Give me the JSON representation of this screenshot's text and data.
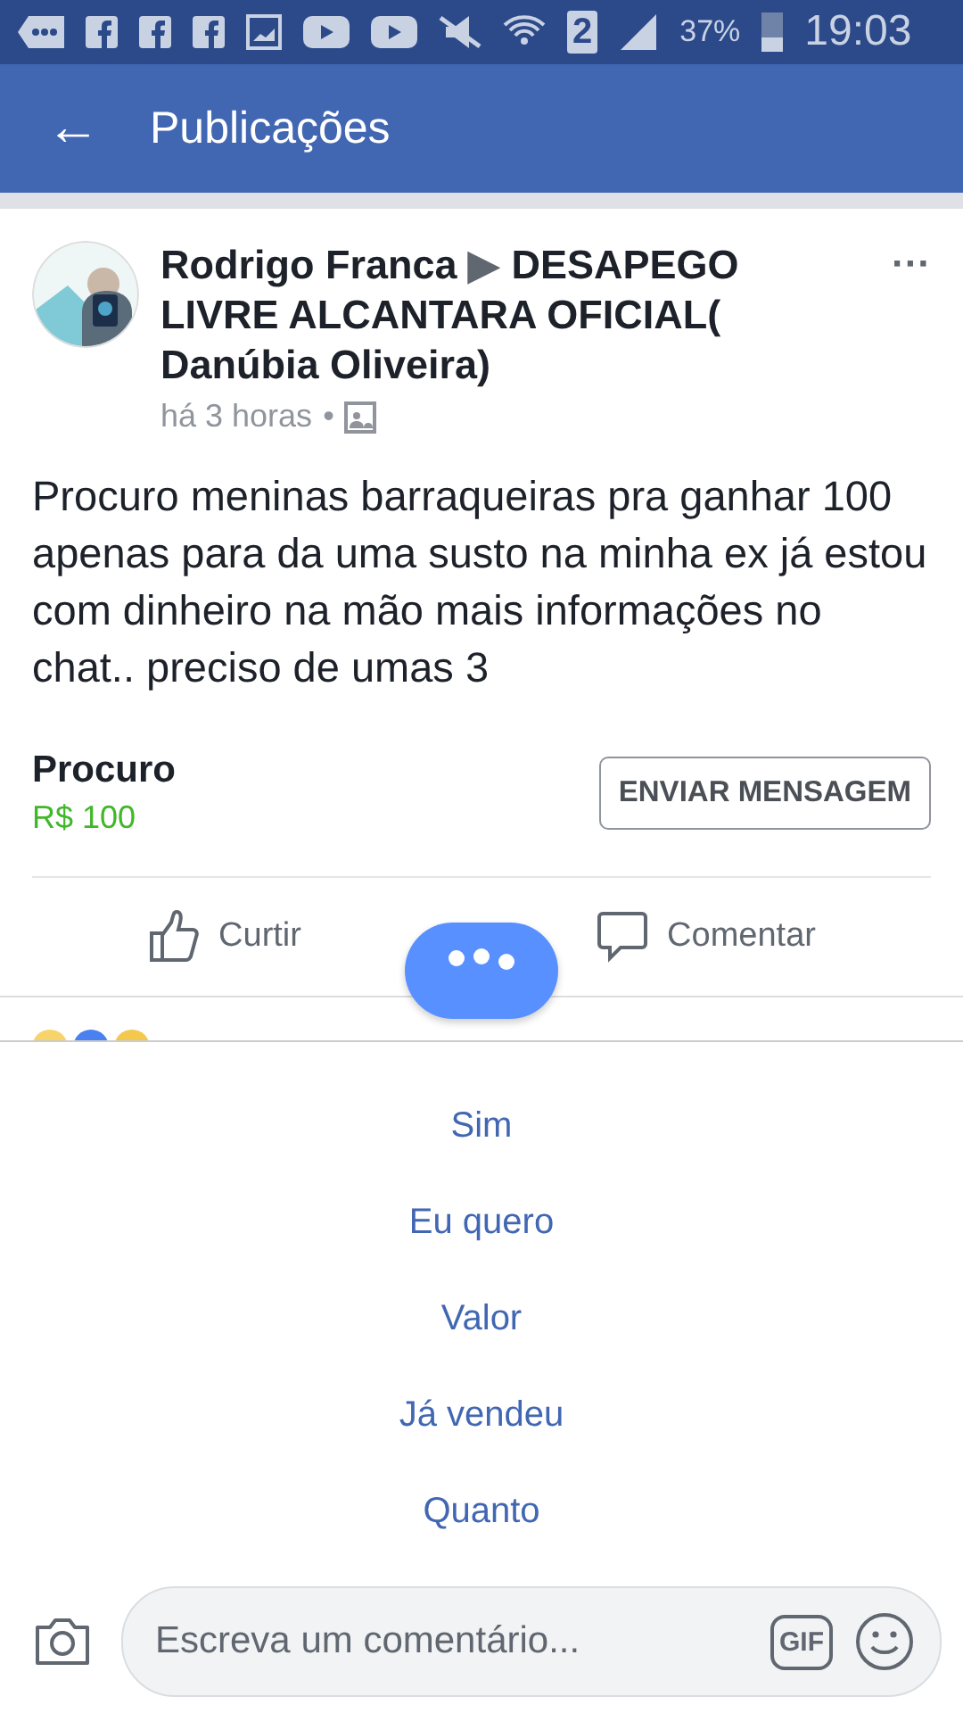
{
  "status_bar": {
    "sim": "2",
    "battery": "37%",
    "time": "19:03"
  },
  "header": {
    "back": "←",
    "title": "Publicações"
  },
  "post": {
    "author": "Rodrigo Franca",
    "arrow": "▶",
    "group": "DESAPEGO LIVRE ALCANTARA OFICIAL( Danúbia Oliveira)",
    "time": "há 3 horas",
    "separator": "•",
    "menu": "···",
    "text": "Procuro meninas barraqueiras pra ganhar 100 apenas para da uma susto na minha ex já estou com dinheiro na mão mais informações no chat.. preciso de umas 3",
    "item_title": "Procuro",
    "price": "R$ 100",
    "message_button": "ENVIAR MENSAGEM",
    "actions": [
      {
        "kind": "like",
        "label": "Curtir"
      },
      {
        "kind": "comment",
        "label": "Comentar"
      }
    ]
  },
  "suggestions": [
    "Sim",
    "Eu quero",
    "Valor",
    "Já vendeu",
    "Quanto"
  ],
  "comment_bar": {
    "placeholder": "Escreva um comentário...",
    "gif": "GIF"
  }
}
